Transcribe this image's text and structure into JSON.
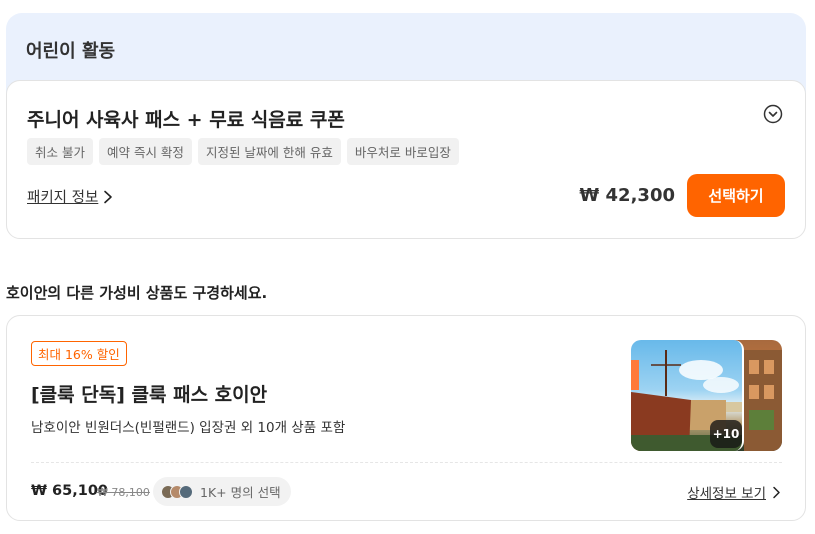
{
  "section": {
    "title": "어린이 활동"
  },
  "package": {
    "title": "주니어 사육사 패스 + 무료 식음료 쿠폰",
    "tags": [
      "취소 불가",
      "예약 즉시 확정",
      "지정된 날짜에 한해 유효",
      "바우처로 바로입장"
    ],
    "info_label": "패키지 정보",
    "price": "₩ 42,300",
    "select_label": "선택하기",
    "accent_color": "#ff6400"
  },
  "promo": {
    "heading": "호이안의 다른 가성비 상품도 구경하세요."
  },
  "product": {
    "discount": "최대 16% 할인",
    "title": "[클룩 단독] 클룩 패스 호이안",
    "description": "남호이안 빈원더스(빈펄랜드) 입장권 외 10개 상품 포함",
    "image_more": "+10",
    "price": "₩ 65,100",
    "original_price": "₩ 78,100",
    "social_proof": "1K+ 명의 선택",
    "details_label": "상세정보 보기"
  }
}
